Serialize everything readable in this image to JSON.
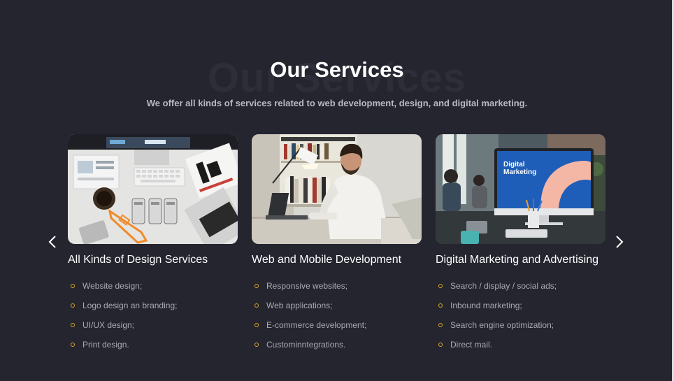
{
  "header": {
    "ghost_title": "Our Services",
    "title": "Our Services",
    "subtitle": "We offer all kinds of services related to web development, design, and digital marketing."
  },
  "carousel": {
    "prev_icon": "chevron-left-icon",
    "next_icon": "chevron-right-icon"
  },
  "cards": [
    {
      "title": "All Kinds of Design Services",
      "items": [
        "Website design;",
        "Logo design an branding;",
        "UI/UX design;",
        "Print design."
      ]
    },
    {
      "title": "Web and Mobile Development",
      "items": [
        "Responsive websites;",
        "Web applications;",
        "E-commerce development;",
        "Custominntegrations."
      ]
    },
    {
      "title": "Digital Marketing and Advertising",
      "image_text": [
        "Digital",
        "Marketing"
      ],
      "items": [
        "Search / display / social ads;",
        "Inbound marketing;",
        "Search engine optimization;",
        "Direct mail."
      ]
    }
  ],
  "colors": {
    "background": "#24252f",
    "bullet": "#d9a72a",
    "title": "#ffffff",
    "text": "#a9aab3"
  }
}
